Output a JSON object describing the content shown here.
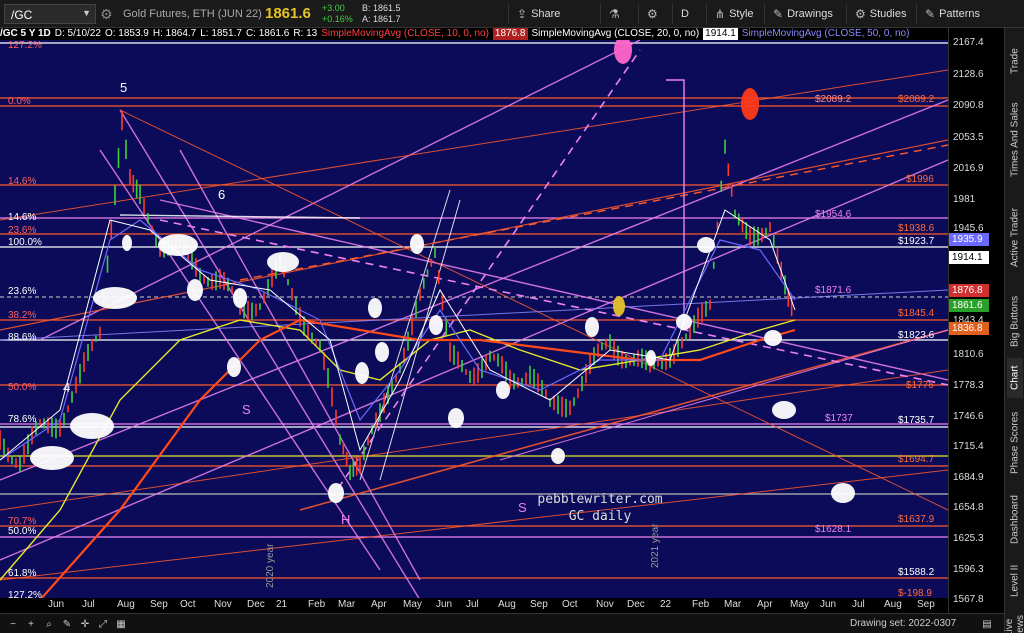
{
  "toolbar": {
    "symbol": "/GC",
    "contract": "Gold Futures, ETH (JUN 22)",
    "last": "1861.6",
    "change_abs": "+3.00",
    "change_pct": "+0.16%",
    "bid": "B: 1861.5",
    "ask": "A: 1861.7",
    "share": "Share",
    "period": "D",
    "style": "Style",
    "drawings": "Drawings",
    "studies": "Studies",
    "patterns": "Patterns"
  },
  "infobar": {
    "title": "/GC 5 Y 1D",
    "date": "D: 5/10/22",
    "open": "O: 1853.9",
    "high": "H: 1864.7",
    "low": "L: 1851.7",
    "close": "C: 1861.6",
    "range": "R: 13",
    "sma10": "SimpleMovingAvg (CLOSE, 10, 0, no)",
    "sma10_val": "1876.8",
    "sma20": "SimpleMovingAvg (CLOSE, 20, 0, no)",
    "sma20_val": "1914.1",
    "sma50": "SimpleMovingAvg (CLOSE, 50, 0, no)"
  },
  "fib_left": [
    {
      "t": "127.2%",
      "c": "#ff6060"
    },
    {
      "t": "0.0%",
      "c": "#ff6060"
    },
    {
      "t": "14.6%",
      "c": "#ff6060"
    },
    {
      "t": "14.6%",
      "c": "#ffffff"
    },
    {
      "t": "23.6%",
      "c": "#ff6060"
    },
    {
      "t": "100.0%",
      "c": "#ffffff"
    },
    {
      "t": "23.6%",
      "c": "#ffffff"
    },
    {
      "t": "38.2%",
      "c": "#ff6060"
    },
    {
      "t": "88.6%",
      "c": "#ffffff"
    },
    {
      "t": "50.0%",
      "c": "#ff6060"
    },
    {
      "t": "78.6%",
      "c": "#ffffff"
    },
    {
      "t": "70.7%",
      "c": "#ff6060"
    },
    {
      "t": "50.0%",
      "c": "#ffffff"
    },
    {
      "t": "61.8%",
      "c": "#ffffff"
    },
    {
      "t": "127.2%",
      "c": "#ffffff"
    }
  ],
  "levels_right": [
    {
      "t": "$2089.2",
      "c": "#ff8a80"
    },
    {
      "t": "$2089.2",
      "c": "#ff6a3a"
    },
    {
      "t": "$1996",
      "c": "#ff6a3a"
    },
    {
      "t": "$1954.6",
      "c": "#ee82ee"
    },
    {
      "t": "$1938.6",
      "c": "#ff6a3a"
    },
    {
      "t": "$1923.7",
      "c": "#ffffff"
    },
    {
      "t": "$1871.6",
      "c": "#ee82ee"
    },
    {
      "t": "$1845.4",
      "c": "#ff6a3a"
    },
    {
      "t": "$1823.6",
      "c": "#ffffff"
    },
    {
      "t": "$1776",
      "c": "#ff6a3a"
    },
    {
      "t": "$1737",
      "c": "#ee82ee"
    },
    {
      "t": "$1735.7",
      "c": "#ffffff"
    },
    {
      "t": "$1694.7",
      "c": "#ff6a3a"
    },
    {
      "t": "$1637.9",
      "c": "#ff6a3a"
    },
    {
      "t": "$1628.1",
      "c": "#ee82ee"
    },
    {
      "t": "$1588.2",
      "c": "#ffffff"
    },
    {
      "t": "$-198.9",
      "c": "#ff6a3a"
    }
  ],
  "price_ticks": [
    "2167.4",
    "2128.6",
    "2090.8",
    "2053.5",
    "2016.9",
    "1981",
    "1945.6",
    "1914.1",
    "1876.8",
    "1861.6",
    "1843.4",
    "1836.8",
    "1810.6",
    "1778.3",
    "1746.6",
    "1715.4",
    "1684.9",
    "1654.8",
    "1625.3",
    "1596.3",
    "1567.8"
  ],
  "price_tags": [
    {
      "t": "1935.9",
      "bg": "#6a6aff",
      "fg": "#ffffff"
    },
    {
      "t": "1914.1",
      "bg": "#ffffff",
      "fg": "#000000"
    },
    {
      "t": "1876.8",
      "bg": "#d03030",
      "fg": "#ffffff"
    },
    {
      "t": "1861.6",
      "bg": "#2aa02a",
      "fg": "#ffffff"
    },
    {
      "t": "1836.8",
      "bg": "#e06020",
      "fg": "#ffffff"
    }
  ],
  "time_ticks": [
    "Jun",
    "Jul",
    "Aug",
    "Sep",
    "Oct",
    "Nov",
    "Dec",
    "21",
    "Feb",
    "Mar",
    "Apr",
    "May",
    "Jun",
    "Jul",
    "Aug",
    "Sep",
    "Oct",
    "Nov",
    "Dec",
    "22",
    "Feb",
    "Mar",
    "Apr",
    "May",
    "Jun",
    "Jul",
    "Aug",
    "Sep"
  ],
  "annotations": {
    "watermark_line1": "pebblewriter.com",
    "watermark_line2": "GC daily",
    "wave_5": "5",
    "wave_4": "4",
    "wave_6": "6",
    "s1": "S",
    "h": "H",
    "s2": "S",
    "year_2020": "2020 year",
    "year_2021": "2021 year"
  },
  "side_tabs": [
    "Trade",
    "Times And Sales",
    "Active Trader",
    "Big Buttons",
    "Chart",
    "Phase Scores",
    "Dashboard",
    "Level II",
    "Live News"
  ],
  "status": {
    "drawing_set": "Drawing set: 2022-0307"
  }
}
